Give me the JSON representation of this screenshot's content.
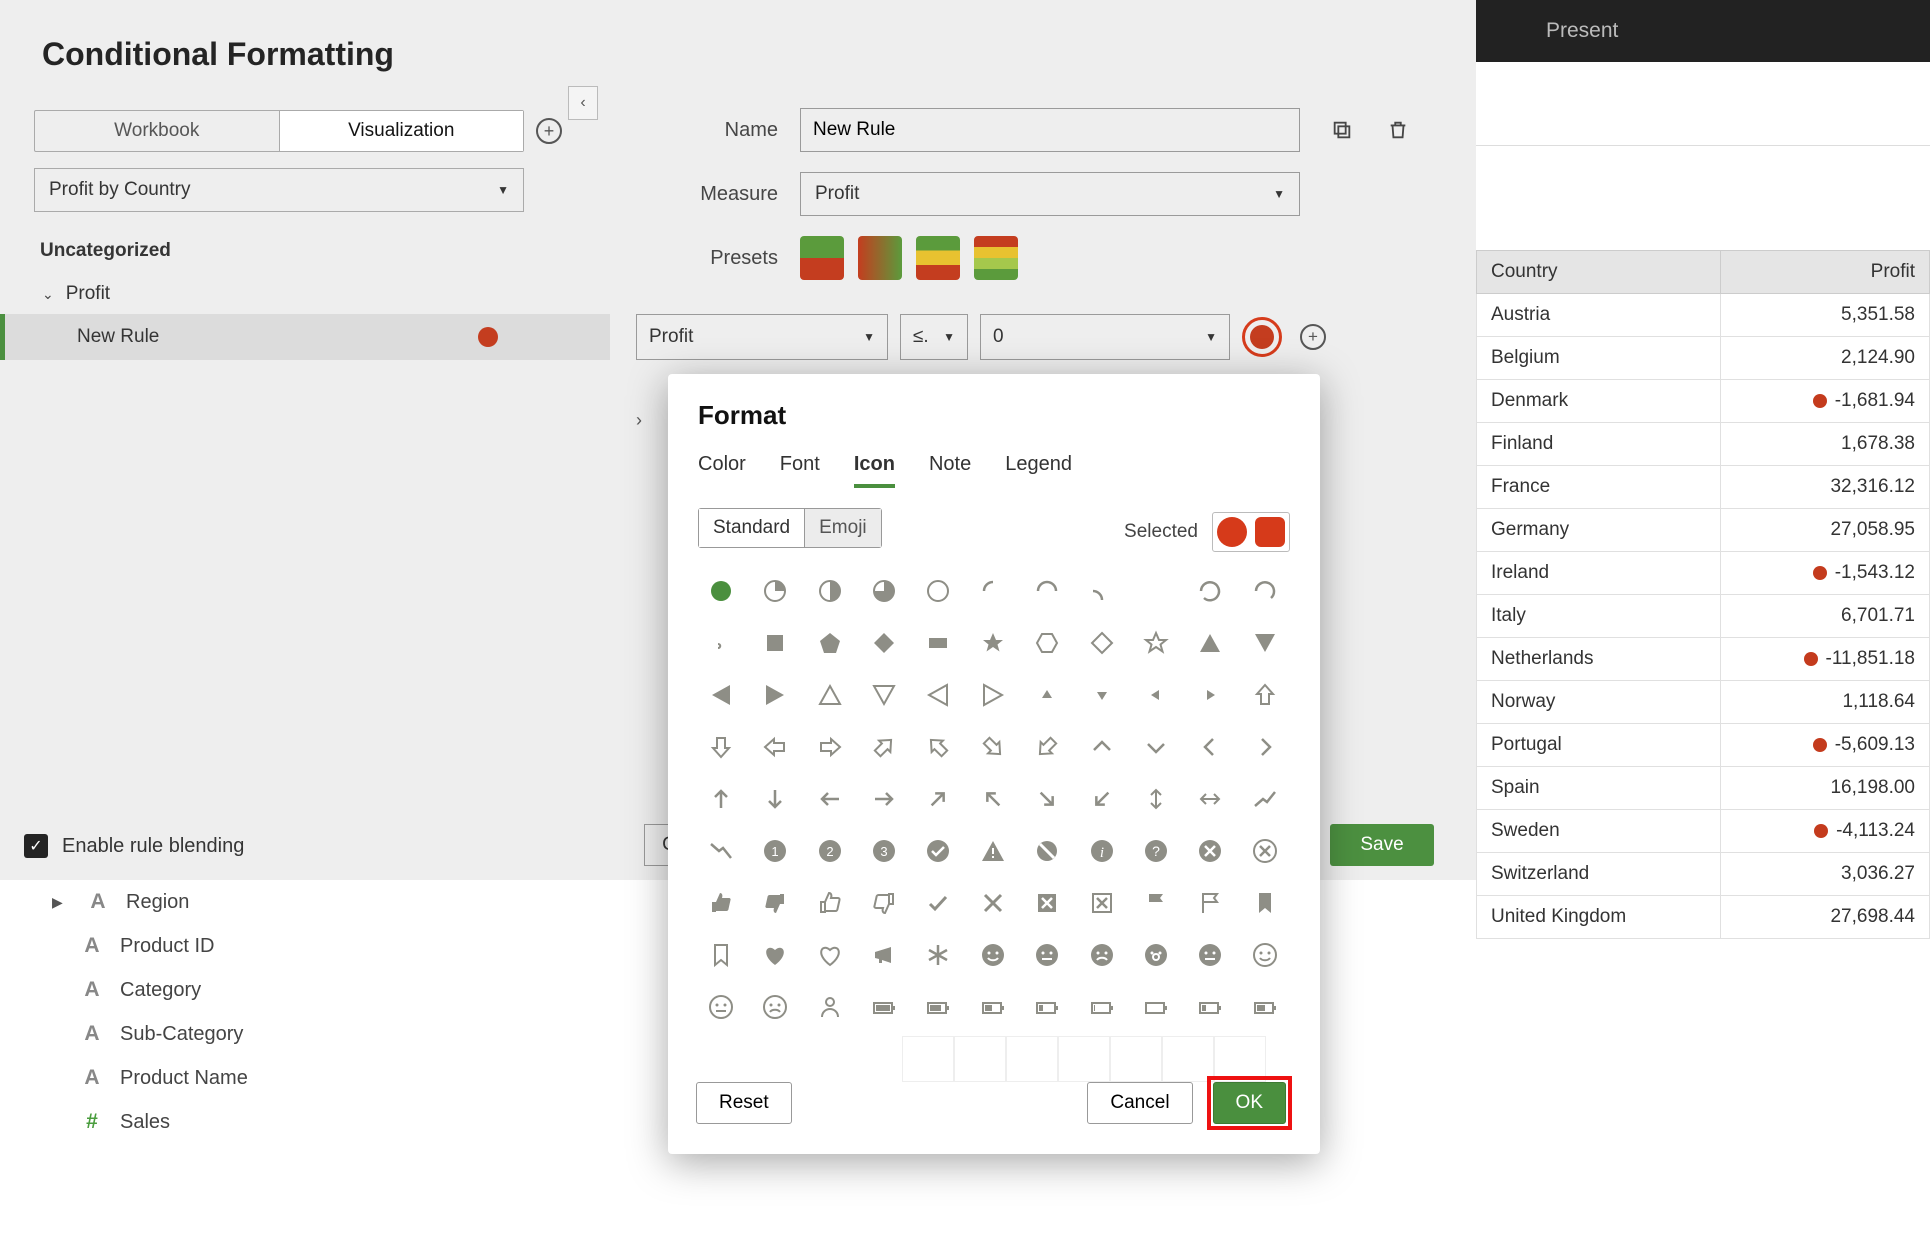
{
  "topbar": {
    "present": "Present"
  },
  "panel": {
    "title": "Conditional Formatting",
    "tabs": {
      "workbook": "Workbook",
      "visualization": "Visualization"
    },
    "scope_selector": "Profit by Country",
    "tree": {
      "section": "Uncategorized",
      "parent": "Profit",
      "child": "New Rule"
    },
    "blend_label": "Enable rule blending"
  },
  "form": {
    "name_label": "Name",
    "name_value": "New Rule",
    "measure_label": "Measure",
    "measure_value": "Profit",
    "presets_label": "Presets",
    "cond_field": "Profit",
    "cond_op": "≤.",
    "cond_value": "0",
    "save": "Save",
    "cancel_partial": "C"
  },
  "popup": {
    "title": "Format",
    "tabs": {
      "color": "Color",
      "font": "Font",
      "icon": "Icon",
      "note": "Note",
      "legend": "Legend"
    },
    "icon_mode": {
      "standard": "Standard",
      "emoji": "Emoji"
    },
    "selected_label": "Selected",
    "reset": "Reset",
    "cancel": "Cancel",
    "ok": "OK"
  },
  "fields": {
    "items": [
      {
        "label": "Region",
        "glyph": "A",
        "caret": true
      },
      {
        "label": "Product ID",
        "glyph": "A"
      },
      {
        "label": "Category",
        "glyph": "A"
      },
      {
        "label": "Sub-Category",
        "glyph": "A"
      },
      {
        "label": "Product Name",
        "glyph": "A"
      },
      {
        "label": "Sales",
        "glyph": "#",
        "num": true
      }
    ]
  },
  "table": {
    "headers": {
      "country": "Country",
      "profit": "Profit"
    },
    "rows": [
      {
        "country": "Austria",
        "profit": "5,351.58",
        "neg": false
      },
      {
        "country": "Belgium",
        "profit": "2,124.90",
        "neg": false
      },
      {
        "country": "Denmark",
        "profit": "-1,681.94",
        "neg": true
      },
      {
        "country": "Finland",
        "profit": "1,678.38",
        "neg": false
      },
      {
        "country": "France",
        "profit": "32,316.12",
        "neg": false
      },
      {
        "country": "Germany",
        "profit": "27,058.95",
        "neg": false
      },
      {
        "country": "Ireland",
        "profit": "-1,543.12",
        "neg": true
      },
      {
        "country": "Italy",
        "profit": "6,701.71",
        "neg": false
      },
      {
        "country": "Netherlands",
        "profit": "-11,851.18",
        "neg": true
      },
      {
        "country": "Norway",
        "profit": "1,118.64",
        "neg": false
      },
      {
        "country": "Portugal",
        "profit": "-5,609.13",
        "neg": true
      },
      {
        "country": "Spain",
        "profit": "16,198.00",
        "neg": false
      },
      {
        "country": "Sweden",
        "profit": "-4,113.24",
        "neg": true
      },
      {
        "country": "Switzerland",
        "profit": "3,036.27",
        "neg": false
      },
      {
        "country": "United Kingdom",
        "profit": "27,698.44",
        "neg": false
      }
    ]
  },
  "icon_names": [
    "circle-filled",
    "circle-q1",
    "circle-half",
    "circle-q3",
    "circle-outline",
    "arc1",
    "arc2",
    "arc3",
    "arc4",
    "arc5",
    "arc6",
    "comma",
    "square-filled",
    "pentagon",
    "diamond",
    "rect",
    "star-filled",
    "hexagon",
    "diamond-outline",
    "star-outline",
    "triangle-up",
    "triangle-down",
    "tri-left",
    "tri-right",
    "tri-up-outline",
    "tri-down-outline",
    "tri-left-outline",
    "tri-right-outline",
    "small-up",
    "small-down",
    "small-left",
    "small-right",
    "arrow-up-outline",
    "arrow-down-outline",
    "arrow-left-outline",
    "arrow-right-outline",
    "arrow-ne-outline",
    "arrow-nw-outline",
    "arrow-se-outline",
    "arrow-sw-outline",
    "caret-up",
    "caret-down",
    "chevron-left",
    "chevron-right",
    "arrow-up",
    "arrow-down",
    "arrow-left",
    "arrow-right",
    "arrow-ne",
    "arrow-nw",
    "arrow-se",
    "arrow-sw",
    "arrows-v",
    "arrows-h",
    "trend-up",
    "trend-down",
    "num-1",
    "num-2",
    "num-3",
    "check-circle",
    "warning",
    "ban",
    "info",
    "question",
    "x-circle",
    "x-circle-outline",
    "thumb-up",
    "thumb-down",
    "thumb-up-outline",
    "thumb-down-outline",
    "check",
    "x",
    "x-box-filled",
    "x-box-outline",
    "flag-filled",
    "flag-outline",
    "bookmark-filled",
    "bookmark-outline",
    "heart-filled",
    "heart-outline",
    "megaphone",
    "asterisk",
    "face-smile",
    "face-neutral",
    "face-frown",
    "face-surprise",
    "face-meh",
    "face-smile-outline",
    "face-neutral-outline",
    "face-frown-outline",
    "person",
    "battery-full",
    "battery-75",
    "battery-50",
    "battery-25",
    "battery-empty",
    "battery-outline",
    "battery-low",
    "battery-mid"
  ]
}
